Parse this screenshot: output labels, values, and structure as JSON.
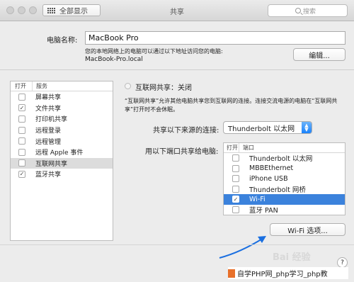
{
  "window": {
    "title": "共享",
    "show_all_label": "全部显示",
    "search_placeholder": "搜索"
  },
  "computer_name": {
    "label": "电脑名称:",
    "value": "MacBook Pro",
    "hint_line1": "您的本地网络上的电脑可以通过以下地址访问您的电脑:",
    "hint_line2": "MacBook-Pro.local",
    "edit_label": "编辑..."
  },
  "services": {
    "header_on": "打开",
    "header_name": "服务",
    "items": [
      {
        "label": "屏幕共享",
        "checked": false,
        "selected": false
      },
      {
        "label": "文件共享",
        "checked": true,
        "selected": false
      },
      {
        "label": "打印机共享",
        "checked": false,
        "selected": false
      },
      {
        "label": "远程登录",
        "checked": false,
        "selected": false
      },
      {
        "label": "远程管理",
        "checked": false,
        "selected": false
      },
      {
        "label": "远程 Apple 事件",
        "checked": false,
        "selected": false
      },
      {
        "label": "互联网共享",
        "checked": false,
        "selected": true
      },
      {
        "label": "蓝牙共享",
        "checked": true,
        "selected": false
      }
    ]
  },
  "internet_sharing": {
    "status": "互联网共享：关闭",
    "description": "“互联网共享”允许其他电脑共享您到互联网的连接。连接交流电源的电脑在“互联网共享”打开时不会休眠。",
    "share_from_label": "共享以下来源的连接:",
    "share_from_value": "Thunderbolt 以太网",
    "share_to_label": "用以下端口共享给电脑:",
    "ports_header_on": "打开",
    "ports_header_port": "端口",
    "ports": [
      {
        "label": "Thunderbolt 以太网",
        "checked": false,
        "selected": false
      },
      {
        "label": "MBBEthernet",
        "checked": false,
        "selected": false
      },
      {
        "label": "iPhone USB",
        "checked": false,
        "selected": false
      },
      {
        "label": "Thunderbolt 网桥",
        "checked": false,
        "selected": false
      },
      {
        "label": "Wi-Fi",
        "checked": true,
        "selected": true
      },
      {
        "label": "蓝牙 PAN",
        "checked": false,
        "selected": false
      }
    ],
    "wifi_options_label": "Wi-Fi 选项..."
  },
  "help_label": "?",
  "watermark": {
    "baidu": "Bai 经验",
    "footer": "自学PHP网_php学习_php教"
  },
  "colors": {
    "selection_blue": "#3b82dc",
    "arrow_blue": "#1a6fe0"
  }
}
